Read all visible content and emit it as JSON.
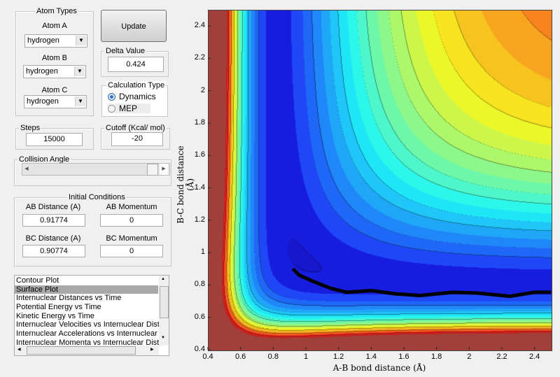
{
  "atom_types": {
    "title": "Atom Types",
    "atom_a_label": "Atom A",
    "atom_a": "hydrogen",
    "atom_b_label": "Atom B",
    "atom_b": "hydrogen",
    "atom_c_label": "Atom C",
    "atom_c": "hydrogen"
  },
  "update_label": "Update",
  "delta": {
    "title": "Delta Value",
    "value": "0.424"
  },
  "calc_type": {
    "title": "Calculation Type",
    "options": [
      "Dynamics",
      "MEP"
    ],
    "selected": "Dynamics"
  },
  "steps": {
    "title": "Steps",
    "value": "15000"
  },
  "cutoff": {
    "title": "Cutoff (Kcal/ mol)",
    "value": "-20"
  },
  "collision": {
    "title": "Collision Angle",
    "slider_value_fraction": 0.0
  },
  "initial": {
    "title": "Initial Conditions",
    "ab_dist_label": "AB Distance (A)",
    "ab_dist": "0.91774",
    "ab_mom_label": "AB Momentum",
    "ab_mom": "0",
    "bc_dist_label": "BC Distance (A)",
    "bc_dist": "0.90774",
    "bc_mom_label": "BC Momentum",
    "bc_mom": "0"
  },
  "plot_list": {
    "items": [
      "Contour Plot",
      "Surface Plot",
      "Internuclear Distances vs Time",
      "Potential Energy vs Time",
      "Kinetic Energy vs Time",
      "Internuclear Velocities vs Internuclear Distance",
      "Internuclear Accelerations vs Internuclear Distance",
      "Internuclear Momenta vs Internuclear Distance"
    ],
    "selected": "Surface Plot"
  },
  "chart_data": {
    "type": "heatmap",
    "xlabel": "A-B bond distance (Å)",
    "ylabel": "B-C bond distance (Å)",
    "xlim": [
      0.4,
      2.5
    ],
    "ylim": [
      0.4,
      2.5
    ],
    "xticks": [
      "0.4",
      "0.6",
      "0.8",
      "1",
      "1.2",
      "1.4",
      "1.6",
      "1.8",
      "2",
      "2.2",
      "2.4"
    ],
    "yticks": [
      "0.4",
      "0.6",
      "0.8",
      "1",
      "1.2",
      "1.4",
      "1.6",
      "1.8",
      "2",
      "2.2",
      "2.4"
    ],
    "colormap": "jet",
    "trajectory": [
      [
        0.92,
        0.9
      ],
      [
        0.96,
        0.86
      ],
      [
        1.05,
        0.82
      ],
      [
        1.15,
        0.78
      ],
      [
        1.25,
        0.755
      ],
      [
        1.4,
        0.765
      ],
      [
        1.55,
        0.745
      ],
      [
        1.7,
        0.735
      ],
      [
        1.9,
        0.755
      ],
      [
        2.05,
        0.75
      ],
      [
        2.25,
        0.73
      ],
      [
        2.4,
        0.755
      ],
      [
        2.5,
        0.755
      ]
    ],
    "trajectory_color": "#000000"
  }
}
